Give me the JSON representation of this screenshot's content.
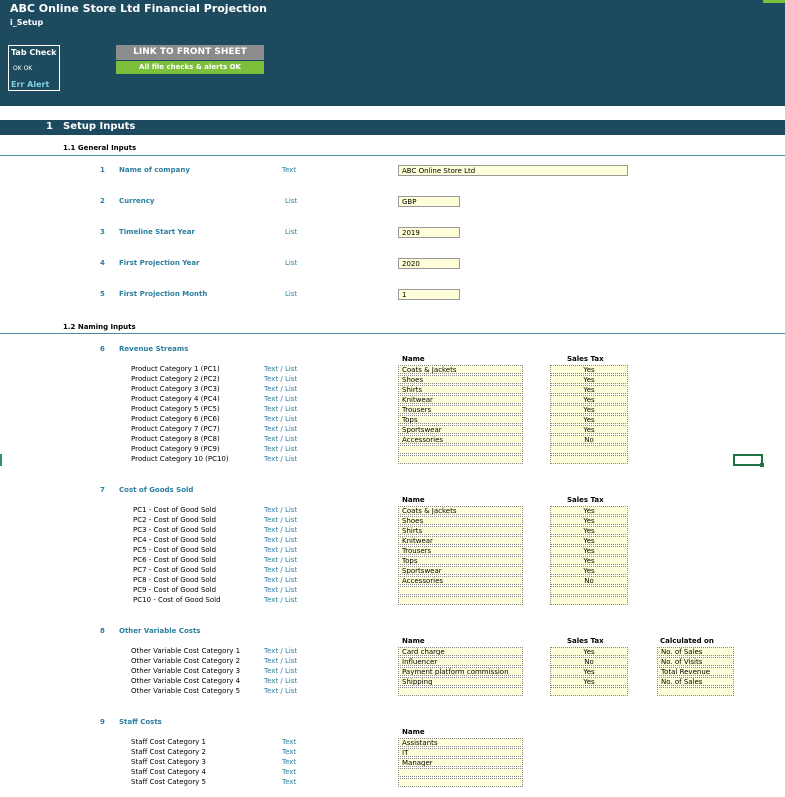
{
  "title": "ABC Online Store Ltd Financial Projection",
  "sheet": "i_Setup",
  "tab_check": {
    "title": "Tab Check",
    "status": "OK  OK",
    "alert": "Err Alert"
  },
  "buttons": {
    "link_front": "LINK TO FRONT SHEET",
    "checks": "All file checks & alerts OK"
  },
  "section": {
    "num": "1",
    "label": "Setup Inputs"
  },
  "general": {
    "heading": "1.1   General Inputs",
    "rows": [
      {
        "num": "1",
        "label": "Name of company",
        "type": "Text",
        "value": "ABC Online Store Ltd"
      },
      {
        "num": "2",
        "label": "Currency",
        "type": "List",
        "value": "GBP"
      },
      {
        "num": "3",
        "label": "Timeline Start Year",
        "type": "List",
        "value": "2019"
      },
      {
        "num": "4",
        "label": "First Projection Year",
        "type": "List",
        "value": "2020"
      },
      {
        "num": "5",
        "label": "First Projection Month",
        "type": "List",
        "value": "1"
      }
    ]
  },
  "naming": {
    "heading": "1.2   Naming Inputs",
    "col_name": "Name",
    "col_tax": "Sales Tax",
    "col_calc": "Calculated on",
    "revenue": {
      "num": "6",
      "label": "Revenue Streams",
      "rows": [
        {
          "cat": "Product Category 1 (PC1)",
          "type": "Text / List",
          "name": "Coats & Jackets",
          "tax": "Yes"
        },
        {
          "cat": "Product Category 2 (PC2)",
          "type": "Text / List",
          "name": "Shoes",
          "tax": "Yes"
        },
        {
          "cat": "Product Category 3 (PC3)",
          "type": "Text / List",
          "name": "Shirts",
          "tax": "Yes"
        },
        {
          "cat": "Product Category 4 (PC4)",
          "type": "Text / List",
          "name": "Knitwear",
          "tax": "Yes"
        },
        {
          "cat": "Product Category 5 (PC5)",
          "type": "Text / List",
          "name": "Trousers",
          "tax": "Yes"
        },
        {
          "cat": "Product Category 6 (PC6)",
          "type": "Text / List",
          "name": "Tops",
          "tax": "Yes"
        },
        {
          "cat": "Product Category 7 (PC7)",
          "type": "Text / List",
          "name": "Sportswear",
          "tax": "Yes"
        },
        {
          "cat": "Product Category 8 (PC8)",
          "type": "Text / List",
          "name": "Accessories",
          "tax": "No"
        },
        {
          "cat": "Product Category 9 (PC9)",
          "type": "Text / List",
          "name": "",
          "tax": ""
        },
        {
          "cat": "Product Category 10 (PC10)",
          "type": "Text / List",
          "name": "",
          "tax": ""
        }
      ]
    },
    "cogs": {
      "num": "7",
      "label": "Cost of Goods Sold",
      "rows": [
        {
          "cat": "PC1 - Cost of Good Sold",
          "type": "Text / List",
          "name": "Coats & Jackets",
          "tax": "Yes"
        },
        {
          "cat": "PC2 - Cost of Good Sold",
          "type": "Text / List",
          "name": "Shoes",
          "tax": "Yes"
        },
        {
          "cat": "PC3 - Cost of Good Sold",
          "type": "Text / List",
          "name": "Shirts",
          "tax": "Yes"
        },
        {
          "cat": "PC4 - Cost of Good Sold",
          "type": "Text / List",
          "name": "Knitwear",
          "tax": "Yes"
        },
        {
          "cat": "PC5 - Cost of Good Sold",
          "type": "Text / List",
          "name": "Trousers",
          "tax": "Yes"
        },
        {
          "cat": "PC6 - Cost of Good Sold",
          "type": "Text / List",
          "name": "Tops",
          "tax": "Yes"
        },
        {
          "cat": "PC7 - Cost of Good Sold",
          "type": "Text / List",
          "name": "Sportswear",
          "tax": "Yes"
        },
        {
          "cat": "PC8 - Cost of Good Sold",
          "type": "Text / List",
          "name": "Accessories",
          "tax": "No"
        },
        {
          "cat": "PC9 - Cost of Good Sold",
          "type": "Text / List",
          "name": "",
          "tax": ""
        },
        {
          "cat": "PC10 - Cost of Good Sold",
          "type": "Text / List",
          "name": "",
          "tax": ""
        }
      ]
    },
    "ovc": {
      "num": "8",
      "label": "Other Variable Costs",
      "rows": [
        {
          "cat": "Other Variable Cost Category 1",
          "type": "Text / List",
          "name": "Card charge",
          "tax": "Yes",
          "calc": "No. of Sales"
        },
        {
          "cat": "Other Variable Cost Category 2",
          "type": "Text / List",
          "name": "Influencer",
          "tax": "No",
          "calc": "No. of Visits"
        },
        {
          "cat": "Other Variable Cost Category 3",
          "type": "Text / List",
          "name": "Payment platform commission",
          "tax": "Yes",
          "calc": "Total Revenue"
        },
        {
          "cat": "Other Variable Cost Category 4",
          "type": "Text / List",
          "name": "Shipping",
          "tax": "Yes",
          "calc": "No. of Sales"
        },
        {
          "cat": "Other Variable Cost Category 5",
          "type": "Text / List",
          "name": "",
          "tax": "",
          "calc": ""
        }
      ]
    },
    "staff": {
      "num": "9",
      "label": "Staff Costs",
      "rows": [
        {
          "cat": "Staff Cost Category 1",
          "type": "Text",
          "name": "Assistants"
        },
        {
          "cat": "Staff Cost Category 2",
          "type": "Text",
          "name": "IT"
        },
        {
          "cat": "Staff Cost Category 3",
          "type": "Text",
          "name": "Manager"
        },
        {
          "cat": "Staff Cost Category 4",
          "type": "Text",
          "name": ""
        },
        {
          "cat": "Staff Cost Category 5",
          "type": "Text",
          "name": ""
        }
      ]
    }
  }
}
